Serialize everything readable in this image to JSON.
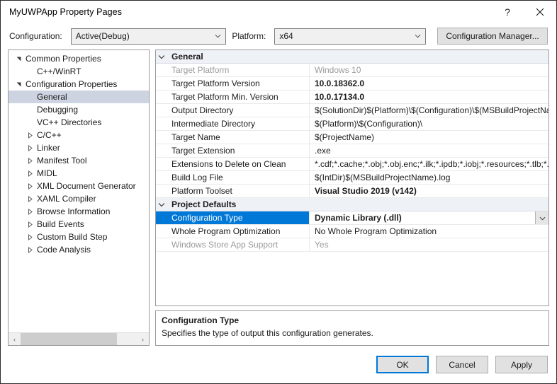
{
  "window": {
    "title": "MyUWPApp Property Pages",
    "help_label": "?",
    "close_label": "Close",
    "accent_color": "#0078d7",
    "tree_selection_color": "#cdd3e0",
    "category_row_color": "#eef1f6"
  },
  "configbar": {
    "configuration_label": "Configuration:",
    "configuration_value": "Active(Debug)",
    "platform_label": "Platform:",
    "platform_value": "x64",
    "configuration_manager_label": "Configuration Manager..."
  },
  "tree": {
    "items": [
      {
        "label": "Common Properties",
        "depth": 1,
        "state": "expanded",
        "selected": false
      },
      {
        "label": "C++/WinRT",
        "depth": 2,
        "state": "leaf",
        "selected": false
      },
      {
        "label": "Configuration Properties",
        "depth": 1,
        "state": "expanded",
        "selected": false
      },
      {
        "label": "General",
        "depth": 2,
        "state": "leaf",
        "selected": true
      },
      {
        "label": "Debugging",
        "depth": 2,
        "state": "leaf",
        "selected": false
      },
      {
        "label": "VC++ Directories",
        "depth": 2,
        "state": "leaf",
        "selected": false
      },
      {
        "label": "C/C++",
        "depth": 2,
        "state": "collapsed",
        "selected": false
      },
      {
        "label": "Linker",
        "depth": 2,
        "state": "collapsed",
        "selected": false
      },
      {
        "label": "Manifest Tool",
        "depth": 2,
        "state": "collapsed",
        "selected": false
      },
      {
        "label": "MIDL",
        "depth": 2,
        "state": "collapsed",
        "selected": false
      },
      {
        "label": "XML Document Generator",
        "depth": 2,
        "state": "collapsed",
        "selected": false
      },
      {
        "label": "XAML Compiler",
        "depth": 2,
        "state": "collapsed",
        "selected": false
      },
      {
        "label": "Browse Information",
        "depth": 2,
        "state": "collapsed",
        "selected": false
      },
      {
        "label": "Build Events",
        "depth": 2,
        "state": "collapsed",
        "selected": false
      },
      {
        "label": "Custom Build Step",
        "depth": 2,
        "state": "collapsed",
        "selected": false
      },
      {
        "label": "Code Analysis",
        "depth": 2,
        "state": "collapsed",
        "selected": false
      }
    ],
    "scroll_left_label": "‹",
    "scroll_right_label": "›"
  },
  "grid": {
    "rows": [
      {
        "kind": "category",
        "name": "General",
        "value": "",
        "state": "expanded"
      },
      {
        "kind": "property",
        "name": "Target Platform",
        "value": "Windows 10",
        "disabled": true,
        "bold": false
      },
      {
        "kind": "property",
        "name": "Target Platform Version",
        "value": "10.0.18362.0",
        "disabled": false,
        "bold": true
      },
      {
        "kind": "property",
        "name": "Target Platform Min. Version",
        "value": "10.0.17134.0",
        "disabled": false,
        "bold": true
      },
      {
        "kind": "property",
        "name": "Output Directory",
        "value": "$(SolutionDir)$(Platform)\\$(Configuration)\\$(MSBuildProjectName)\\",
        "disabled": false,
        "bold": false
      },
      {
        "kind": "property",
        "name": "Intermediate Directory",
        "value": "$(Platform)\\$(Configuration)\\",
        "disabled": false,
        "bold": false
      },
      {
        "kind": "property",
        "name": "Target Name",
        "value": "$(ProjectName)",
        "disabled": false,
        "bold": false
      },
      {
        "kind": "property",
        "name": "Target Extension",
        "value": ".exe",
        "disabled": false,
        "bold": false
      },
      {
        "kind": "property",
        "name": "Extensions to Delete on Clean",
        "value": "*.cdf;*.cache;*.obj;*.obj.enc;*.ilk;*.ipdb;*.iobj;*.resources;*.tlb;*.tli;*.tlh;*.tmp",
        "disabled": false,
        "bold": false
      },
      {
        "kind": "property",
        "name": "Build Log File",
        "value": "$(IntDir)$(MSBuildProjectName).log",
        "disabled": false,
        "bold": false
      },
      {
        "kind": "property",
        "name": "Platform Toolset",
        "value": "Visual Studio 2019 (v142)",
        "disabled": false,
        "bold": true
      },
      {
        "kind": "category",
        "name": "Project Defaults",
        "value": "",
        "state": "expanded"
      },
      {
        "kind": "property",
        "name": "Configuration Type",
        "value": "Dynamic Library (.dll)",
        "disabled": false,
        "bold": true,
        "selected": true,
        "editor": "dropdown"
      },
      {
        "kind": "property",
        "name": "Whole Program Optimization",
        "value": "No Whole Program Optimization",
        "disabled": false,
        "bold": false
      },
      {
        "kind": "property",
        "name": "Windows Store App Support",
        "value": "Yes",
        "disabled": true,
        "bold": false
      }
    ]
  },
  "description": {
    "title": "Configuration Type",
    "text": "Specifies the type of output this configuration generates."
  },
  "footer": {
    "ok_label": "OK",
    "cancel_label": "Cancel",
    "apply_label": "Apply"
  }
}
